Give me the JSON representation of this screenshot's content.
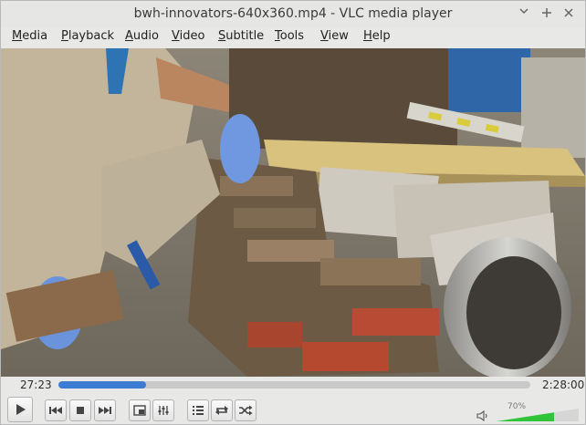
{
  "window": {
    "title": "bwh-innovators-640x360.mp4 - VLC media player",
    "minimize": "⌄",
    "maximize": "+",
    "close": "×"
  },
  "menu": [
    {
      "label": "Media",
      "key": "M",
      "rest": "edia"
    },
    {
      "label": "Playback",
      "key": "P",
      "rest": "layback"
    },
    {
      "label": "Audio",
      "key": "A",
      "rest": "udio"
    },
    {
      "label": "Video",
      "key": "V",
      "rest": "ideo"
    },
    {
      "label": "Subtitle",
      "key": "S",
      "rest": "ubtitle"
    },
    {
      "label": "Tools",
      "key": "T",
      "rest": "ools"
    },
    {
      "label": "View",
      "key": "V",
      "rest": "iew"
    },
    {
      "label": "Help",
      "key": "H",
      "rest": "elp"
    }
  ],
  "player": {
    "elapsed": "27:23",
    "duration": "2:28:00",
    "progress_fraction": 0.185,
    "volume_label": "70%",
    "volume_fraction": 0.7
  },
  "colors": {
    "seek_fill": "#3b7bd1",
    "volume_fill": "#2fc43a"
  },
  "icons": {
    "play": "play-icon",
    "previous": "previous-icon",
    "stop": "stop-icon",
    "next": "next-icon",
    "fullscreen": "fullscreen-icon",
    "extended": "extended-settings-icon",
    "playlist": "playlist-icon",
    "loop": "loop-icon",
    "random": "random-icon",
    "volume": "speaker-icon"
  }
}
